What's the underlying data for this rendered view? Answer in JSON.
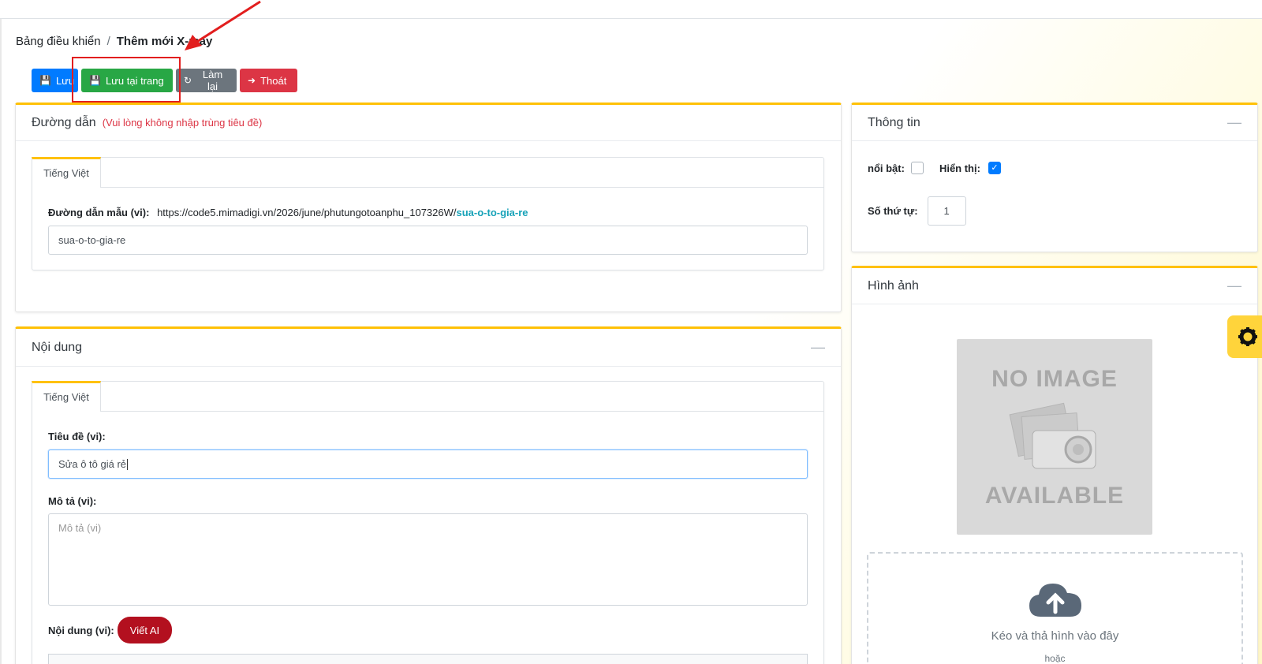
{
  "breadcrumb": {
    "home": "Bảng điều khiển",
    "separator": "/",
    "current": "Thêm mới X-may"
  },
  "toolbar": {
    "save": "Lưu",
    "save_stay": "Lưu tại trang",
    "reset": "Làm lại",
    "exit": "Thoát"
  },
  "path_card": {
    "title": "Đường dẫn",
    "note": "(Vui lòng không nhập trùng tiêu đề)",
    "tab": "Tiếng Việt",
    "sample_label": "Đường dẫn mẫu (vi):",
    "sample_base": "https://code5.mimadigi.vn/2026/june/phutungotoanphu_107326W/",
    "sample_slug": "sua-o-to-gia-re",
    "slug_value": "sua-o-to-gia-re"
  },
  "content_card": {
    "title": "Nội dung",
    "collapse": "—",
    "tab": "Tiếng Việt",
    "title_label": "Tiêu đề (vi):",
    "title_value": "Sửa ô tô giá rẻ",
    "desc_label": "Mô tả (vi):",
    "desc_placeholder": "Mô tả (vi)",
    "body_label": "Nội dung (vi):",
    "ai_button": "Viết AI"
  },
  "info_card": {
    "title": "Thông tin",
    "collapse": "—",
    "featured_label": "nổi bật:",
    "featured_checked": false,
    "visible_label": "Hiển thị:",
    "visible_checked": true,
    "order_label": "Số thứ tự:",
    "order_value": "1"
  },
  "image_card": {
    "title": "Hình ảnh",
    "collapse": "—",
    "no_image_top": "NO IMAGE",
    "no_image_bottom": "AVAILABLE",
    "drop_text": "Kéo và thả hình vào đây",
    "or_text": "hoặc"
  },
  "icons": [
    "save-icon",
    "save-stay-icon",
    "refresh-icon",
    "sign-out-icon",
    "cloud-upload-icon",
    "gear-icon",
    "camera-icon"
  ],
  "colors": {
    "accent": "#ffc107",
    "primary": "#007bff",
    "success": "#28a745",
    "secondary": "#6c757d",
    "danger": "#dc3545",
    "ai": "#b3101f"
  }
}
